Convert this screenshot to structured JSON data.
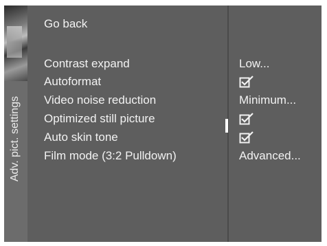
{
  "menu": {
    "side_label": "Adv. pict. settings",
    "go_back": "Go back",
    "items": [
      {
        "label": "Contrast expand",
        "value": "Low...",
        "type": "text"
      },
      {
        "label": "Autoformat",
        "value": "checked",
        "type": "checkbox"
      },
      {
        "label": "Video noise reduction",
        "value": "Minimum...",
        "type": "text"
      },
      {
        "label": "Optimized still picture",
        "value": "checked",
        "type": "checkbox"
      },
      {
        "label": "Auto skin tone",
        "value": "checked",
        "type": "checkbox"
      },
      {
        "label": "Film mode (3:2 Pulldown)",
        "value": "Advanced...",
        "type": "text"
      }
    ],
    "selected_index": 3,
    "colors": {
      "menu_bg": "#5e5e5e",
      "text": "#f2f2f2"
    }
  }
}
